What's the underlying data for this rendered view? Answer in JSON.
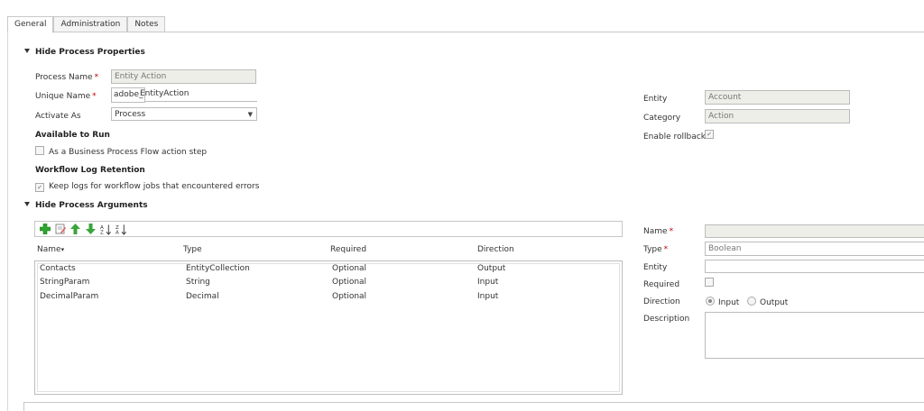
{
  "tabs": [
    {
      "label": "General"
    },
    {
      "label": "Administration"
    },
    {
      "label": "Notes"
    }
  ],
  "properties": {
    "section_title": "Hide Process Properties",
    "process_name_label": "Process Name",
    "process_name_value": "Entity Action",
    "unique_name_label": "Unique Name",
    "unique_name_prefix": "adobe_",
    "unique_name_value": "EntityAction",
    "activate_as_label": "Activate As",
    "activate_as_value": "Process",
    "available_to_run_label": "Available to Run",
    "bpf_step_label": "As a Business Process Flow action step",
    "log_retention_label": "Workflow Log Retention",
    "keep_logs_label": "Keep logs for workflow jobs that encountered errors",
    "entity_label": "Entity",
    "entity_value": "Account",
    "category_label": "Category",
    "category_value": "Action",
    "enable_rollback_label": "Enable rollback"
  },
  "arguments": {
    "section_title": "Hide Process Arguments",
    "columns": [
      "Name",
      "Type",
      "Required",
      "Direction"
    ],
    "rows": [
      {
        "name": "Contacts",
        "type": "EntityCollection",
        "required": "Optional",
        "direction": "Output"
      },
      {
        "name": "StringParam",
        "type": "String",
        "required": "Optional",
        "direction": "Input"
      },
      {
        "name": "DecimalParam",
        "type": "Decimal",
        "required": "Optional",
        "direction": "Input"
      }
    ]
  },
  "arg_detail": {
    "name_label": "Name",
    "name_value": "",
    "type_label": "Type",
    "type_value": "Boolean",
    "entity_label": "Entity",
    "entity_value": "",
    "required_label": "Required",
    "direction_label": "Direction",
    "direction_input": "Input",
    "direction_output": "Output",
    "description_label": "Description"
  },
  "symbols": {
    "required": "*",
    "sort_arrow": "▾",
    "dropdown_arrow": "▼",
    "check": "✔"
  },
  "colors": {
    "required_marker": "#c00000",
    "readonly_bg": "#eeeee8",
    "add_icon": "#2fa52f",
    "arrow_icon": "#3aa43a"
  },
  "icons": [
    "add-icon",
    "edit-icon",
    "move-up-icon",
    "move-down-icon",
    "sort-ascending-icon",
    "sort-descending-icon"
  ]
}
